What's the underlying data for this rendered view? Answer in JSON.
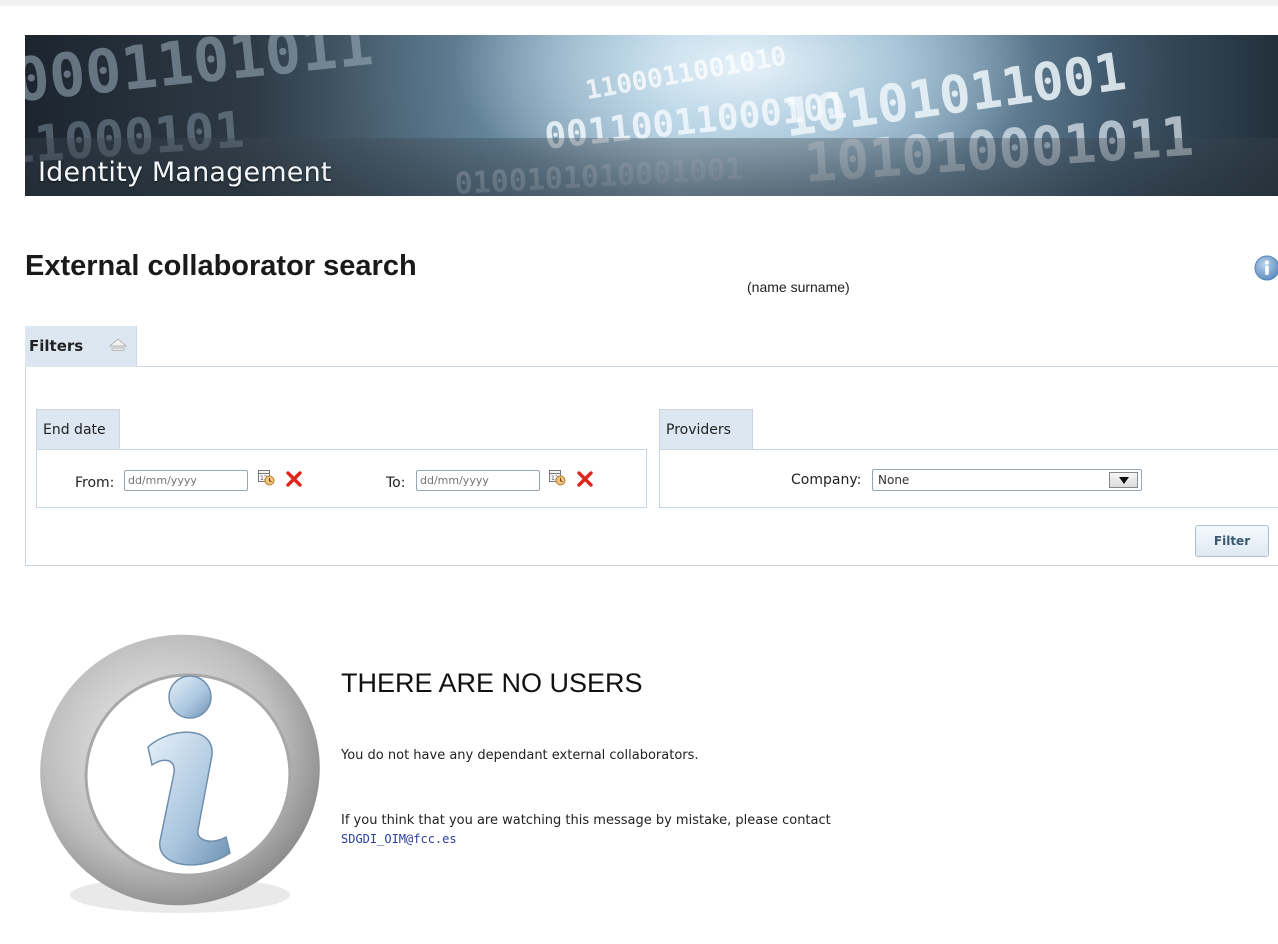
{
  "header": {
    "title": "Identity Management",
    "digits": [
      "0001101011",
      "1100011001010",
      "10101011001",
      "00110011000101",
      "101010001011",
      "0100101010001001",
      "11000101"
    ]
  },
  "page": {
    "title": "External collaborator search",
    "name_hint": "(name surname)",
    "help_icon": "info-icon"
  },
  "filters": {
    "tab_label": "Filters",
    "collapse_icon": "collapse-up-icon",
    "end_date": {
      "label": "End date",
      "from_label": "From:",
      "from_placeholder": "dd/mm/yyyy",
      "to_label": "To:",
      "to_placeholder": "dd/mm/yyyy",
      "calendar_icon": "calendar-icon",
      "clear_icon": "clear-x-icon"
    },
    "providers": {
      "label": "Providers",
      "company_label": "Company:",
      "company_value": "None"
    },
    "filter_button": "Filter"
  },
  "empty_state": {
    "icon": "info-icon",
    "title": "THERE ARE NO USERS",
    "message": "You do not have any dependant external collaborators.",
    "contact_text": "If you think that you are watching this message by mistake, please contact",
    "email": "SDGDI_OIM@fcc.es"
  },
  "colors": {
    "tab_background": "#dde7f1",
    "border": "#cbd5de",
    "link": "#2a3fa0",
    "clear_red": "#e0261c",
    "info_blue": "#7aa7d4"
  }
}
